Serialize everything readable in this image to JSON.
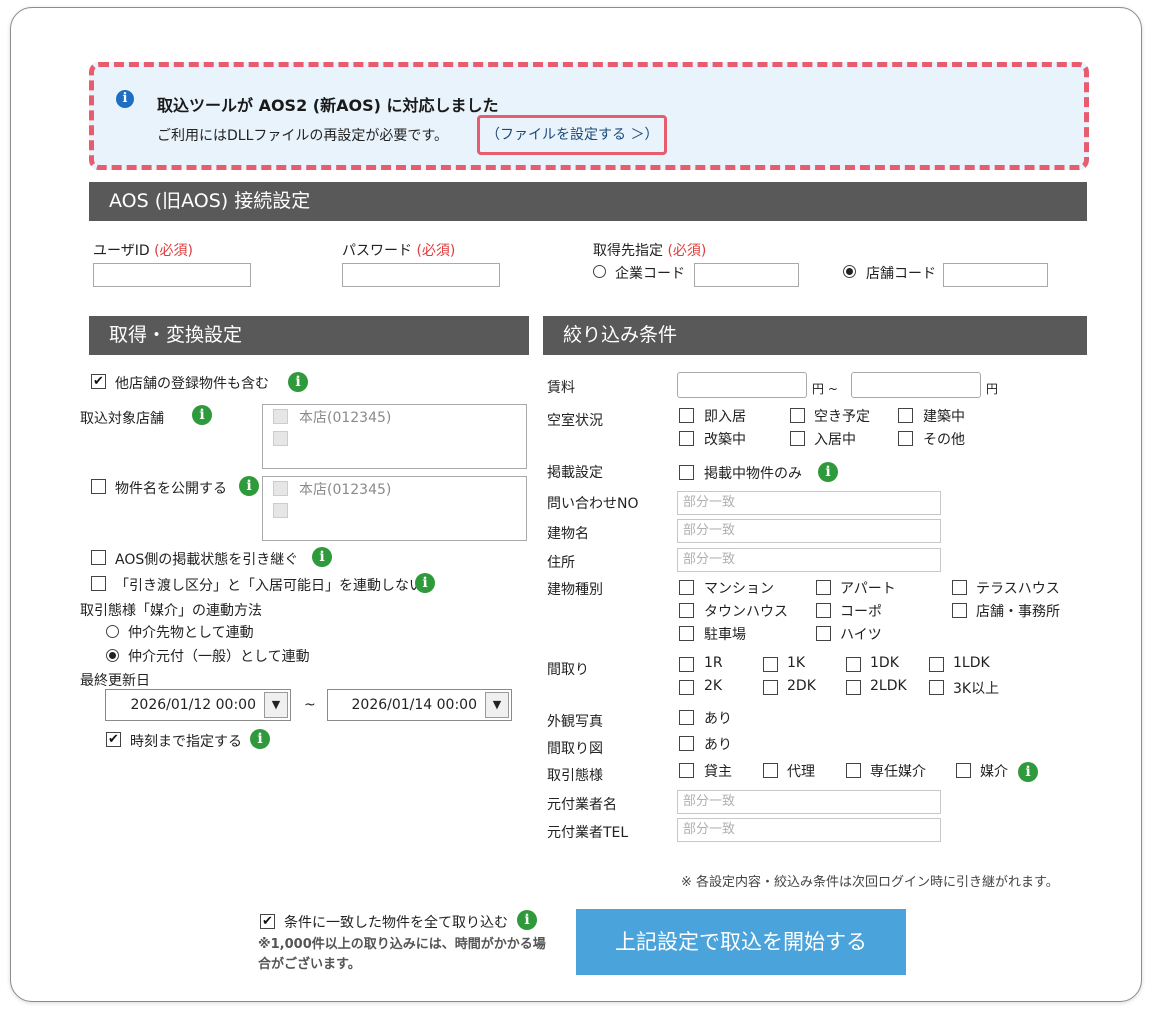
{
  "notice": {
    "title": "取込ツールが AOS2 (新AOS) に対応しました",
    "text": "ご利用にはDLLファイルの再設定が必要です。",
    "link": "（ファイルを設定する ＞）"
  },
  "aos_section": {
    "title": "AOS (旧AOS) 接続設定",
    "user_id_label": "ユーザID",
    "password_label": "パスワード",
    "target_label": "取得先指定",
    "required": "(必須)",
    "company_code": "企業コード",
    "store_code": "店舗コード",
    "selected_target": "店舗コード"
  },
  "acq_section": {
    "title": "取得・変換設定",
    "include_other_stores": "他店舗の登録物件も含む",
    "target_stores_label": "取込対象店舗",
    "store_item": "本店(012345)",
    "publish_name": "物件名を公開する",
    "inherit_status": "AOS側の掲載状態を引き継ぐ",
    "no_link": "「引き渡し区分」と「入居可能日」を連動しない",
    "transaction_link_label": "取引態様「媒介」の連動方法",
    "opt_agent_dest": "仲介先物として連動",
    "opt_agent_origin": "仲介元付（一般）として連動",
    "last_updated_label": "最終更新日",
    "date_from": "2026/01/12 00:00",
    "date_to": "2026/01/14 00:00",
    "tilde": "~",
    "specify_time": "時刻まで指定する"
  },
  "filter_section": {
    "title": "絞り込み条件",
    "rent_label": "賃料",
    "yen_tilde": "円 ~",
    "yen": "円",
    "vacancy_label": "空室状況",
    "vacancy_options": [
      "即入居",
      "空き予定",
      "建築中",
      "改築中",
      "入居中",
      "その他"
    ],
    "listing_label": "掲載設定",
    "listing_only": "掲載中物件のみ",
    "inquiry_label": "問い合わせNO",
    "building_name_label": "建物名",
    "address_label": "住所",
    "partial_match": "部分一致",
    "building_type_label": "建物種別",
    "building_types": [
      "マンション",
      "アパート",
      "テラスハウス",
      "タウンハウス",
      "コーポ",
      "店舗・事務所",
      "駐車場",
      "ハイツ"
    ],
    "layout_label": "間取り",
    "layouts": [
      "1R",
      "1K",
      "1DK",
      "1LDK",
      "2K",
      "2DK",
      "2LDK",
      "3K以上"
    ],
    "exterior_photo_label": "外観写真",
    "floor_plan_label": "間取り図",
    "exists": "あり",
    "transaction_label": "取引態様",
    "transaction_types": [
      "貸主",
      "代理",
      "専任媒介",
      "媒介"
    ],
    "origin_name_label": "元付業者名",
    "origin_tel_label": "元付業者TEL"
  },
  "footer": {
    "note": "※ 各設定内容・絞込み条件は次回ログイン時に引き継がれます。",
    "import_all": "条件に一致した物件を全て取り込む",
    "import_note": "※1,000件以上の取り込みには、時間がかかる場合がございます。",
    "start_button": "上記設定で取込を開始する"
  },
  "colors": {
    "accent_button": "#4aa3db",
    "section_header": "#595959",
    "notice_border": "#e75d6f",
    "notice_bg": "#e9f3fb",
    "required": "#e03c3c",
    "info_green": "#2e9a3c"
  }
}
